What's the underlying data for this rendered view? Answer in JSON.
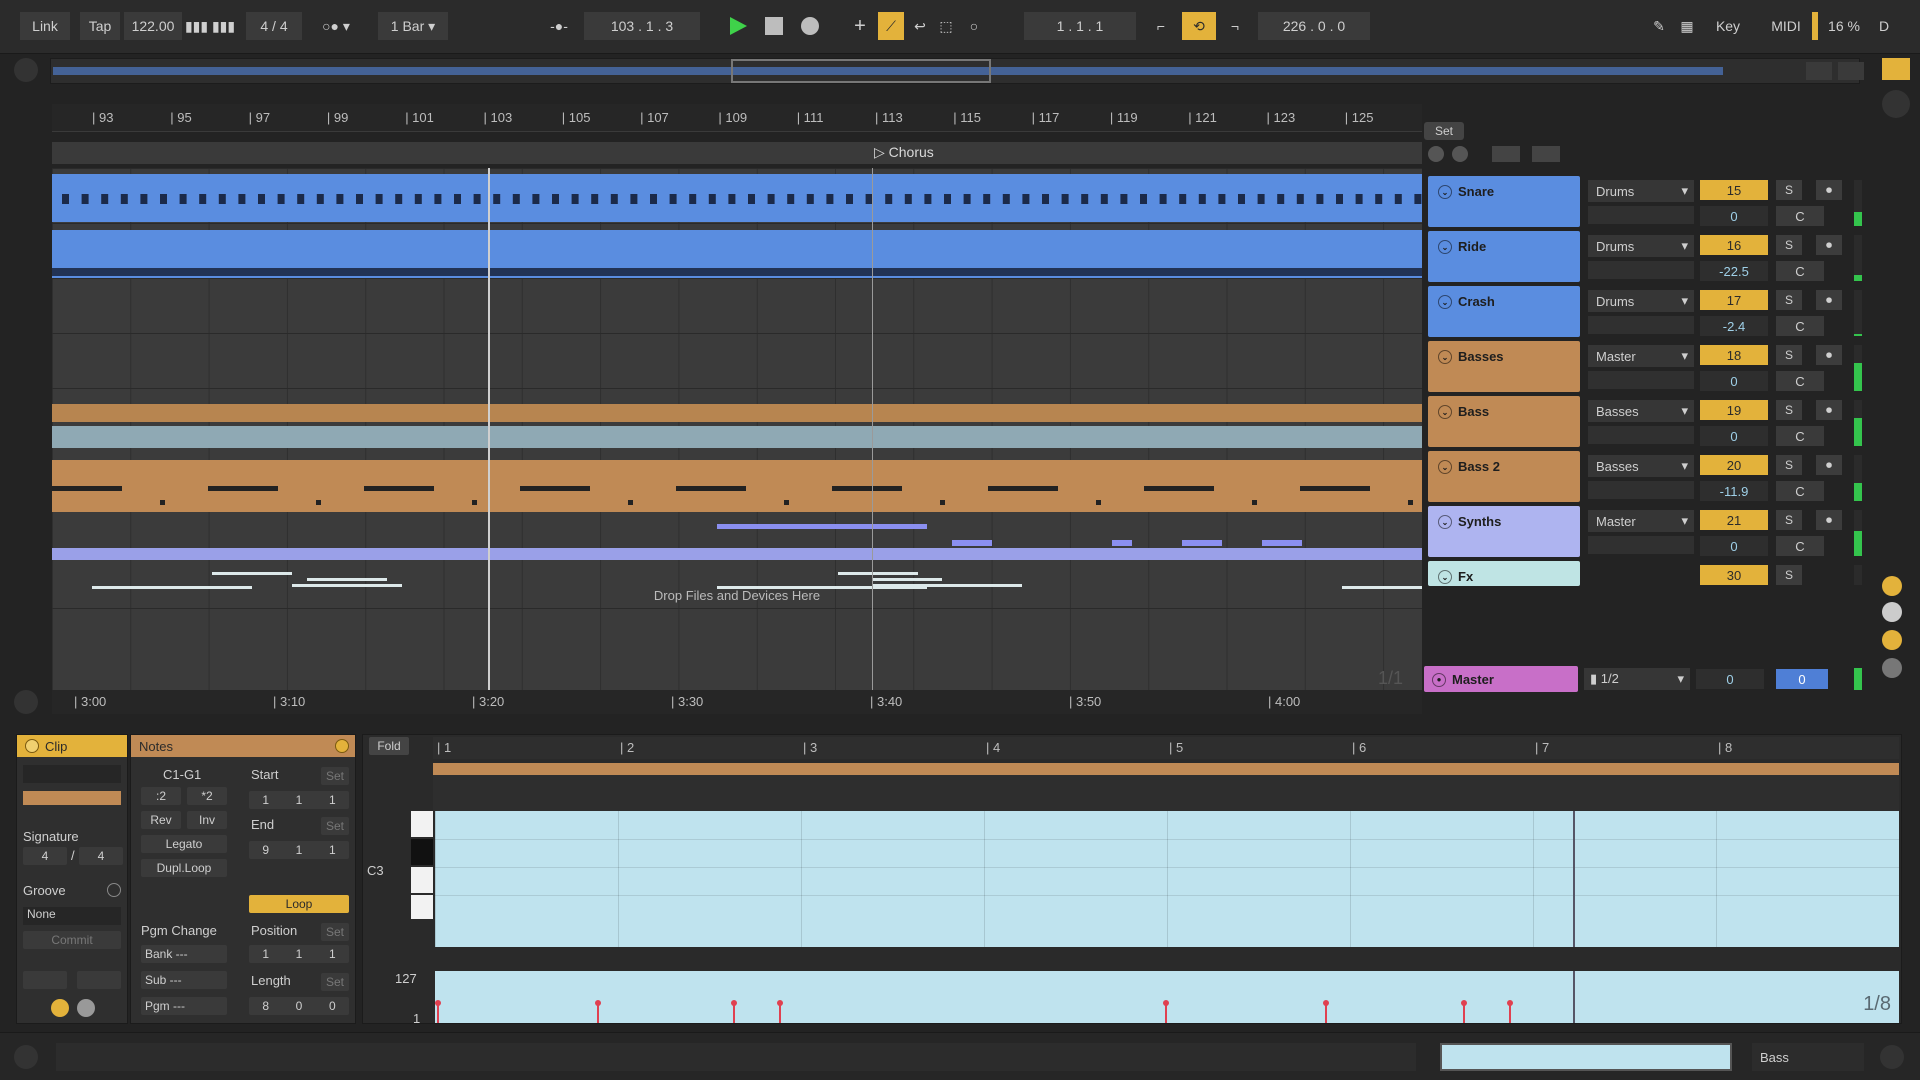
{
  "transport": {
    "link": "Link",
    "tap": "Tap",
    "tempo": "122.00",
    "signature": "4 / 4",
    "quantize": "1 Bar",
    "position": "103 .  1 .  3",
    "loop_start": "1 .  1 .  1",
    "loop_length": "226 .  0 .  0",
    "key": "Key",
    "midi": "MIDI",
    "cpu": "16 %",
    "disk": "D"
  },
  "ruler": {
    "bars": [
      "93",
      "95",
      "97",
      "99",
      "101",
      "103",
      "105",
      "107",
      "109",
      "111",
      "113",
      "115",
      "117",
      "119",
      "121",
      "123",
      "125"
    ],
    "times": [
      "3:00",
      "3:10",
      "3:20",
      "3:30",
      "3:40",
      "3:50",
      "4:00"
    ]
  },
  "locator": "Chorus",
  "set_label": "Set",
  "drop_hint": "Drop Files and Devices Here",
  "page_indicator": "1/1",
  "tracks": [
    {
      "name": "Snare",
      "color": "#5a8de0",
      "routing": "Drums",
      "number": "15",
      "volume": "0",
      "pan": "C"
    },
    {
      "name": "Ride",
      "color": "#5a8de0",
      "routing": "Drums",
      "number": "16",
      "volume": "-22.5",
      "pan": "C"
    },
    {
      "name": "Crash",
      "color": "#5a8de0",
      "routing": "Drums",
      "number": "17",
      "volume": "-2.4",
      "pan": "C"
    },
    {
      "name": "Basses",
      "color": "#c08a55",
      "routing": "Master",
      "number": "18",
      "volume": "0",
      "pan": "C"
    },
    {
      "name": "Bass",
      "color": "#c08a55",
      "routing": "Basses",
      "number": "19",
      "volume": "0",
      "pan": "C"
    },
    {
      "name": "Bass 2",
      "color": "#c08a55",
      "routing": "Basses",
      "number": "20",
      "volume": "-11.9",
      "pan": "C"
    },
    {
      "name": "Synths",
      "color": "#aeb4f0",
      "routing": "Master",
      "number": "21",
      "volume": "0",
      "pan": "C"
    },
    {
      "name": "Fx",
      "color": "#bfe4e4",
      "routing": "",
      "number": "30",
      "volume": "",
      "pan": ""
    }
  ],
  "master": {
    "name": "Master",
    "routing": "1/2",
    "volume": "0",
    "pan": "0",
    "color": "#c86fc8"
  },
  "clip": {
    "title": "Clip",
    "signature_label": "Signature",
    "sig_num": "4",
    "sig_den": "4",
    "groove_label": "Groove",
    "groove_value": "None",
    "commit": "Commit"
  },
  "notes": {
    "title": "Notes",
    "range": "C1-G1",
    "half": ":2",
    "double": "*2",
    "rev": "Rev",
    "inv": "Inv",
    "legato": "Legato",
    "dupl": "Dupl.Loop",
    "pgm_change": "Pgm Change",
    "bank": "Bank ---",
    "sub": "Sub ---",
    "pgm": "Pgm ---",
    "start_label": "Start",
    "start": [
      "1",
      "1",
      "1"
    ],
    "set": "Set",
    "end_label": "End",
    "end": [
      "9",
      "1",
      "1"
    ],
    "loop": "Loop",
    "position_label": "Position",
    "position": [
      "1",
      "1",
      "1"
    ],
    "length_label": "Length",
    "length": [
      "8",
      "0",
      "0"
    ]
  },
  "editor": {
    "fold": "Fold",
    "bars": [
      "1",
      "2",
      "3",
      "4",
      "5",
      "6",
      "7",
      "8"
    ],
    "note_label": "C3",
    "vel_max": "127",
    "vel_min": "1",
    "grid": "1/8"
  },
  "status": {
    "track_label": "Bass"
  }
}
